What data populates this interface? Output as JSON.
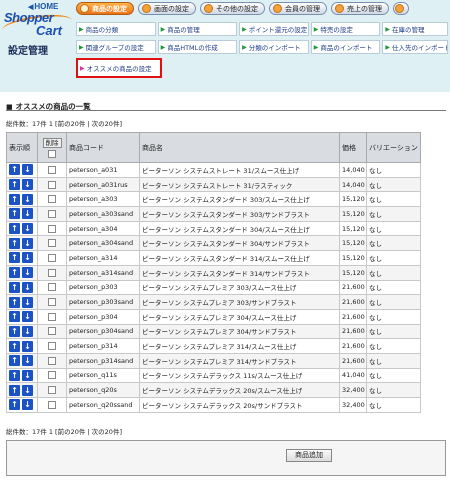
{
  "logo": {
    "home": "HOME",
    "brand1": "Shopper",
    "brand2": "Cart",
    "subtitle": "設定管理"
  },
  "topnav": [
    {
      "label": "商品の設定",
      "active": true
    },
    {
      "label": "画面の設定",
      "active": false
    },
    {
      "label": "その他の設定",
      "active": false
    },
    {
      "label": "会員の管理",
      "active": false
    },
    {
      "label": "売上の管理",
      "active": false
    }
  ],
  "subnav": {
    "row1": [
      "商品の分類",
      "商品の管理",
      "ポイント還元の設定",
      "特売の設定",
      "在庫の管理"
    ],
    "row2": [
      "関連グループの設定",
      "商品HTMLの作成",
      "分類のインポート",
      "商品のインポート",
      "仕入先のインポート"
    ],
    "row3": [
      "オススメの商品の設定"
    ]
  },
  "section_title": "オススメの商品の一覧",
  "pager_top": "総件数：17件 1 [前の20件 | 次の20件]",
  "pager_bottom": "総件数：17件 1 [前の20件 | 次の20件]",
  "table": {
    "headers": {
      "order": "表示順",
      "delete": "削除",
      "code": "商品コード",
      "name": "商品名",
      "price": "価格",
      "variation": "バリエーション"
    },
    "rows": [
      {
        "code": "peterson_a031",
        "name": "ピーターソン システムストレート 31/スムース仕上げ",
        "price": "14,040",
        "variation": "なし"
      },
      {
        "code": "peterson_a031rus",
        "name": "ピーターソン システムストレート 31/ラスティック",
        "price": "14,040",
        "variation": "なし"
      },
      {
        "code": "peterson_a303",
        "name": "ピーターソン システムスタンダード 303/スムース仕上げ",
        "price": "15,120",
        "variation": "なし"
      },
      {
        "code": "peterson_a303sand",
        "name": "ピーターソン システムスタンダード 303/サンドブラスト",
        "price": "15,120",
        "variation": "なし"
      },
      {
        "code": "peterson_a304",
        "name": "ピーターソン システムスタンダード 304/スムース仕上げ",
        "price": "15,120",
        "variation": "なし"
      },
      {
        "code": "peterson_a304sand",
        "name": "ピーターソン システムスタンダード 304/サンドブラスト",
        "price": "15,120",
        "variation": "なし"
      },
      {
        "code": "peterson_a314",
        "name": "ピーターソン システムスタンダード 314/スムース仕上げ",
        "price": "15,120",
        "variation": "なし"
      },
      {
        "code": "peterson_a314sand",
        "name": "ピーターソン システムスタンダード 314/サンドブラスト",
        "price": "15,120",
        "variation": "なし"
      },
      {
        "code": "peterson_p303",
        "name": "ピーターソン システムプレミア 303/スムース仕上げ",
        "price": "21,600",
        "variation": "なし"
      },
      {
        "code": "peterson_p303sand",
        "name": "ピーターソン システムプレミア 303/サンドブラスト",
        "price": "21,600",
        "variation": "なし"
      },
      {
        "code": "peterson_p304",
        "name": "ピーターソン システムプレミア 304/スムース仕上げ",
        "price": "21,600",
        "variation": "なし"
      },
      {
        "code": "peterson_p304sand",
        "name": "ピーターソン システムプレミア 304/サンドブラスト",
        "price": "21,600",
        "variation": "なし"
      },
      {
        "code": "peterson_p314",
        "name": "ピーターソン システムプレミア 314/スムース仕上げ",
        "price": "21,600",
        "variation": "なし"
      },
      {
        "code": "peterson_p314sand",
        "name": "ピーターソン システムプレミア 314/サンドブラスト",
        "price": "21,600",
        "variation": "なし"
      },
      {
        "code": "peterson_q11s",
        "name": "ピーターソン システムデラックス 11s/スムース仕上げ",
        "price": "41,040",
        "variation": "なし"
      },
      {
        "code": "peterson_q20s",
        "name": "ピーターソン システムデラックス 20s/スムース仕上げ",
        "price": "32,400",
        "variation": "なし"
      },
      {
        "code": "peterson_q20ssand",
        "name": "ピーターソン システムデラックス 20s/サンドブラスト",
        "price": "32,400",
        "variation": "なし"
      }
    ]
  },
  "add_button": "商品追加",
  "colors": {
    "accent": "#e8731a",
    "header_bg": "#dff0f4",
    "order_button": "#1c53c4",
    "highlight_border": "#e01010"
  },
  "icons": {
    "order_up": "arrow-up-icon",
    "order_down": "arrow-down-icon",
    "subnav": "triangle-right-icon"
  }
}
